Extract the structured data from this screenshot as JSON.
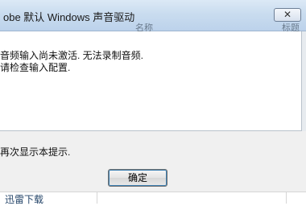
{
  "dialog": {
    "title": "obe 默认 Windows 声音驱动",
    "close_glyph": "✕",
    "message_line1": "音频输入尚未激活. 无法录制音频.",
    "message_line2": "请检查输入配置.",
    "checkbox_label": "再次显示本提示.",
    "ok_label": "确定"
  },
  "background": {
    "column_name_header": "名称",
    "column_tag_header": "标题",
    "download_label": "迅雷下载"
  },
  "colors": {
    "titlebar": "#c9dcef",
    "dialog_bg": "#f0f0f0",
    "button_focus": "#3c7fb1"
  }
}
